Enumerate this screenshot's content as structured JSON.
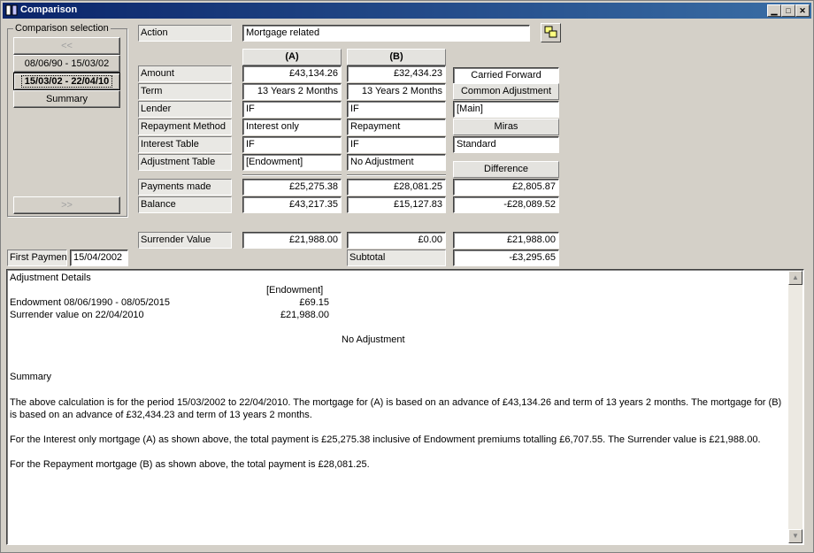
{
  "window": {
    "title": "Comparison"
  },
  "selection": {
    "group_label": "Comparison selection",
    "prev": "<<",
    "next": ">>",
    "periods": [
      "08/06/90 - 15/03/02",
      "15/03/02 - 22/04/10",
      "Summary"
    ],
    "selected_index": 1
  },
  "form": {
    "action_label": "Action",
    "action_value": "Mortgage related",
    "col_a": "(A)",
    "col_b": "(B)",
    "rows": [
      {
        "label": "Amount",
        "a": "£43,134.26",
        "b": "£32,434.23"
      },
      {
        "label": "Term",
        "a": "13 Years 2 Months",
        "b": "13 Years 2 Months"
      },
      {
        "label": "Lender",
        "a": "IF",
        "b": "IF"
      },
      {
        "label": "Repayment Method",
        "a": "Interest only",
        "b": "Repayment"
      },
      {
        "label": "Interest Table",
        "a": "IF",
        "b": "IF"
      },
      {
        "label": "Adjustment Table",
        "a": "[Endowment]",
        "b": "No Adjustment"
      }
    ],
    "right": {
      "carried_forward": "Carried Forward",
      "common_adjustment": "Common Adjustment",
      "main": "[Main]",
      "miras": "Miras",
      "standard": "Standard",
      "difference": "Difference"
    },
    "payments_made": {
      "label": "Payments made",
      "a": "£25,275.38",
      "b": "£28,081.25",
      "diff": "£2,805.87"
    },
    "balance": {
      "label": "Balance",
      "a": "£43,217.35",
      "b": "£15,127.83",
      "diff": "-£28,089.52"
    },
    "surrender": {
      "label": "Surrender Value",
      "a": "£21,988.00",
      "b": "£0.00",
      "diff": "£21,988.00"
    },
    "subtotal": {
      "label": "Subtotal",
      "value": "-£3,295.65"
    },
    "first_payment": {
      "label": "First Payment",
      "value": "15/04/2002"
    }
  },
  "details": {
    "heading": "Adjustment Details",
    "endowment_header": "[Endowment]",
    "line1_label": "Endowment 08/06/1990 - 08/05/2015",
    "line1_value": "£69.15",
    "line2_label": "Surrender value on 22/04/2010",
    "line2_value": "£21,988.00",
    "no_adjustment": "No Adjustment",
    "summary_heading": "Summary",
    "para1": "The above calculation is for the period 15/03/2002 to 22/04/2010. The mortgage for (A) is based on an advance of £43,134.26 and term of 13 years 2 months. The mortgage for (B) is based on an advance of £32,434.23 and term of 13 years 2 months.",
    "para2": "For the Interest only mortgage (A) as shown above, the total payment is £25,275.38 inclusive of Endowment premiums totalling £6,707.55. The Surrender value is £21,988.00.",
    "para3": "For the Repayment mortgage (B) as shown above, the total payment is £28,081.25."
  }
}
